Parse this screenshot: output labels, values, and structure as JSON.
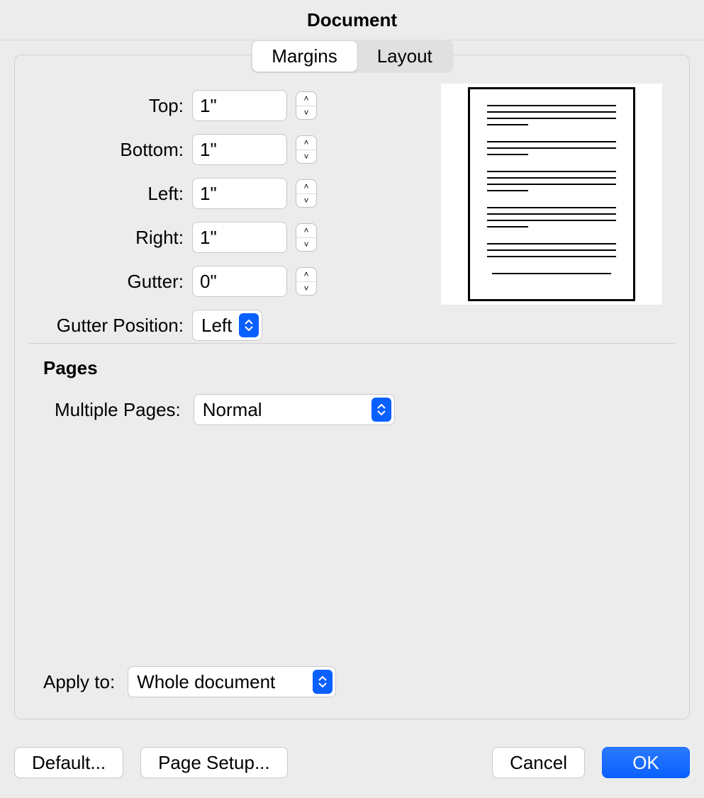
{
  "window": {
    "title": "Document"
  },
  "tabs": {
    "margins": "Margins",
    "layout": "Layout",
    "active": "margins"
  },
  "margins": {
    "top": {
      "label": "Top:",
      "value": "1\""
    },
    "bottom": {
      "label": "Bottom:",
      "value": "1\""
    },
    "left": {
      "label": "Left:",
      "value": "1\""
    },
    "right": {
      "label": "Right:",
      "value": "1\""
    },
    "gutter": {
      "label": "Gutter:",
      "value": "0\""
    },
    "gutter_position": {
      "label": "Gutter Position:",
      "value": "Left"
    }
  },
  "pages": {
    "heading": "Pages",
    "multiple_pages": {
      "label": "Multiple Pages:",
      "value": "Normal"
    }
  },
  "apply_to": {
    "label": "Apply to:",
    "value": "Whole document"
  },
  "buttons": {
    "default": "Default...",
    "page_setup": "Page Setup...",
    "cancel": "Cancel",
    "ok": "OK"
  }
}
